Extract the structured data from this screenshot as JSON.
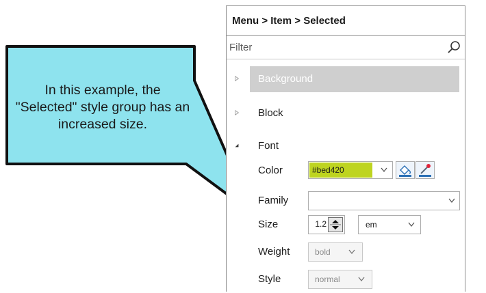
{
  "callout": {
    "text": "In this example, the \"Selected\" style group has an increased size."
  },
  "panel": {
    "breadcrumb": "Menu > Item > Selected",
    "filter_placeholder": "Filter",
    "sections": {
      "background": "Background",
      "block": "Block",
      "font": "Font"
    },
    "font": {
      "color_label": "Color",
      "color_value": "#bed420",
      "family_label": "Family",
      "family_value": "",
      "size_label": "Size",
      "size_value": "1.2",
      "size_unit": "em",
      "weight_label": "Weight",
      "weight_value": "bold",
      "style_label": "Style",
      "style_value": "normal"
    }
  },
  "colors": {
    "swatch": "#bed420",
    "callout_fill": "#8ee3ee",
    "background_bar": "#cfcfcf"
  },
  "icons": {
    "search": "search-icon",
    "fill": "paint-bucket-icon",
    "picker": "eyedropper-icon"
  }
}
